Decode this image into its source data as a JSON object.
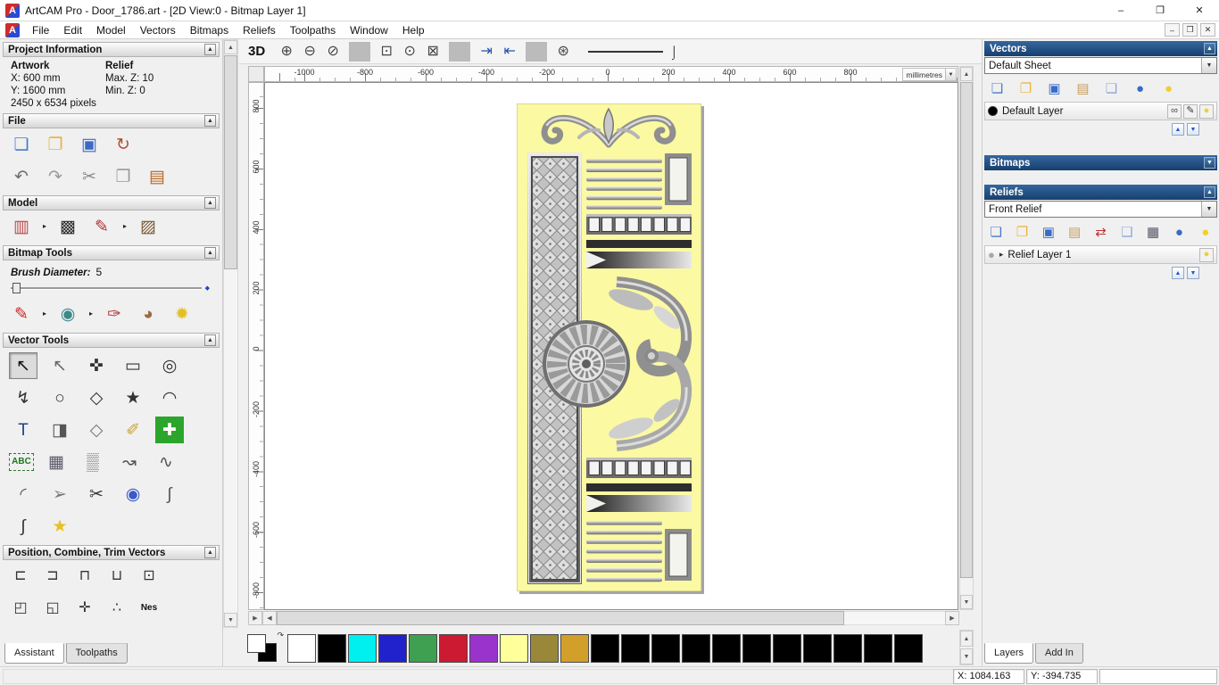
{
  "window": {
    "title": "ArtCAM Pro - Door_1786.art - [2D View:0 - Bitmap Layer 1]",
    "app_initial": "A"
  },
  "glyphs": {
    "up": "▲",
    "down": "▼",
    "left": "◀",
    "right": "▶",
    "combo_down": "▼",
    "minimize": "–",
    "restore": "❐",
    "close": "✕",
    "swap": "↷",
    "expand": "▸",
    "diamond": "◆"
  },
  "menu": {
    "items": [
      "File",
      "Edit",
      "Model",
      "Vectors",
      "Bitmaps",
      "Reliefs",
      "Toolpaths",
      "Window",
      "Help"
    ]
  },
  "assistant": {
    "project_info": {
      "title": "Project Information",
      "artwork_heading": "Artwork",
      "relief_heading": "Relief",
      "artwork_x": "X: 600 mm",
      "artwork_y": "Y: 1600 mm",
      "relief_max": "Max. Z: 10",
      "relief_min": "Min. Z: 0",
      "pixels": "2450 x 6534 pixels"
    },
    "file_section": {
      "title": "File",
      "row1": [
        {
          "name": "new-model-icon",
          "glyph": "❏",
          "color": "#4a7ac8"
        },
        {
          "name": "open-model-icon",
          "glyph": "❐",
          "color": "#e8b43a"
        },
        {
          "name": "save-model-icon",
          "glyph": "▣",
          "color": "#3a6ac8"
        },
        {
          "name": "model-transfer-icon",
          "glyph": "↻",
          "color": "#b05030"
        }
      ],
      "row2": [
        {
          "name": "undo-icon",
          "glyph": "↶",
          "color": "#707070"
        },
        {
          "name": "redo-icon",
          "glyph": "↷",
          "color": "#9a9a9a"
        },
        {
          "name": "cut-icon",
          "glyph": "✂",
          "color": "#8a8a8a"
        },
        {
          "name": "copy-icon",
          "glyph": "❐",
          "color": "#9a9a9a"
        },
        {
          "name": "paste-icon",
          "glyph": "▤",
          "color": "#b5651d"
        }
      ]
    },
    "model_section": {
      "title": "Model",
      "icons": [
        {
          "name": "load-relief-icon",
          "glyph": "▥",
          "color": "#c04848"
        },
        {
          "name": "flyout-arrow-icon",
          "glyph": "▸",
          "color": "#222",
          "cls": "mini"
        },
        {
          "name": "greyscale-view-icon",
          "glyph": "▩",
          "color": "#2e2e2e"
        },
        {
          "name": "shape-editor-icon",
          "glyph": "✎",
          "color": "#b03030"
        },
        {
          "name": "flyout-arrow-icon",
          "glyph": "▸",
          "color": "#222",
          "cls": "mini"
        },
        {
          "name": "load-image-icon",
          "glyph": "▨",
          "color": "#7a5a32"
        }
      ]
    },
    "bitmap_tools": {
      "title": "Bitmap Tools",
      "brush_label": "Brush Diameter:",
      "brush_value": "5",
      "icons": [
        {
          "name": "paint-brush-icon",
          "glyph": "✎",
          "color": "#cc2222"
        },
        {
          "name": "flyout-arrow-icon",
          "glyph": "▸",
          "color": "#222",
          "cls": "mini"
        },
        {
          "name": "flood-fill-icon",
          "glyph": "◉",
          "color": "#3a8a8a"
        },
        {
          "name": "flyout-arrow-icon",
          "glyph": "▸",
          "color": "#222",
          "cls": "mini"
        },
        {
          "name": "draw-colour-icon",
          "glyph": "✑",
          "color": "#b04040"
        },
        {
          "name": "palette-icon",
          "glyph": "◕",
          "color": "#9a6a40"
        },
        {
          "name": "texture-splat-icon",
          "glyph": "✹",
          "color": "#e2c020"
        }
      ]
    },
    "vector_tools": {
      "title": "Vector Tools",
      "rows": [
        [
          {
            "name": "select-vectors-icon",
            "glyph": "↖",
            "color": "#111",
            "pressed": true
          },
          {
            "name": "node-editing-icon",
            "glyph": "↖",
            "color": "#666"
          },
          {
            "name": "transform-vectors-icon",
            "glyph": "✜",
            "color": "#333"
          },
          {
            "name": "rectangle-tool-icon",
            "glyph": "▭",
            "color": "#333"
          },
          {
            "name": "circle-tool-icon",
            "glyph": "◎",
            "color": "#333"
          }
        ],
        [
          {
            "name": "polyline-tool-icon",
            "glyph": "↯",
            "color": "#333"
          },
          {
            "name": "ellipse-tool-icon",
            "glyph": "○",
            "color": "#333"
          },
          {
            "name": "polygon-tool-icon",
            "glyph": "◇",
            "color": "#333"
          },
          {
            "name": "star-tool-icon",
            "glyph": "★",
            "color": "#333"
          },
          {
            "name": "arc-tool-icon",
            "glyph": "◠",
            "color": "#333"
          }
        ],
        [
          {
            "name": "text-tool-icon",
            "glyph": "T",
            "color": "#224488"
          },
          {
            "name": "mirror-vectors-icon",
            "glyph": "◨",
            "color": "#555"
          },
          {
            "name": "offset-vectors-icon",
            "glyph": "◇",
            "color": "#777"
          },
          {
            "name": "measure-tool-icon",
            "glyph": "✐",
            "color": "#c8a030"
          },
          {
            "name": "block-paste-icon",
            "glyph": "✚",
            "color": "#ffffff",
            "bg": "#2ba52b"
          }
        ],
        [
          {
            "name": "text-block-icon",
            "glyph": "ABC",
            "color": "#1a7a1a",
            "cls": "abc"
          },
          {
            "name": "wireframe-icon",
            "glyph": "▦",
            "color": "#556"
          },
          {
            "name": "dot-pattern-icon",
            "glyph": "▒",
            "color": "#666"
          },
          {
            "name": "bezier-curve-icon",
            "glyph": "↝",
            "color": "#555"
          },
          {
            "name": "fit-curves-icon",
            "glyph": "∿",
            "color": "#555"
          }
        ],
        [
          {
            "name": "arc-fit-icon",
            "glyph": "◜",
            "color": "#555"
          },
          {
            "name": "join-vectors-icon",
            "glyph": "➢",
            "color": "#777"
          },
          {
            "name": "trim-vectors-icon",
            "glyph": "✂",
            "color": "#333"
          },
          {
            "name": "vector-doctor-icon",
            "glyph": "◉",
            "color": "#3a5ac8"
          },
          {
            "name": "spline-icon",
            "glyph": "∫",
            "color": "#555"
          }
        ],
        [
          {
            "name": "wrap-text-curve-icon",
            "glyph": "∫",
            "color": "#333"
          },
          {
            "name": "star-wizard-icon",
            "glyph": "★",
            "color": "#e8c020"
          }
        ]
      ]
    },
    "position_section": {
      "title": "Position, Combine, Trim Vectors",
      "row1": [
        {
          "name": "align-left-icon",
          "glyph": "⊏",
          "color": "#333",
          "cls": "small"
        },
        {
          "name": "align-right-icon",
          "glyph": "⊐",
          "color": "#333",
          "cls": "small"
        },
        {
          "name": "align-top-icon",
          "glyph": "⊓",
          "color": "#333",
          "cls": "small"
        },
        {
          "name": "align-bottom-icon",
          "glyph": "⊔",
          "color": "#333",
          "cls": "small"
        },
        {
          "name": "align-centre-icon",
          "glyph": "⊡",
          "color": "#333",
          "cls": "small"
        }
      ],
      "row2": [
        {
          "name": "combine-union-icon",
          "glyph": "◰",
          "color": "#333",
          "cls": "small"
        },
        {
          "name": "combine-subtract-icon",
          "glyph": "◱",
          "color": "#333",
          "cls": "small"
        },
        {
          "name": "weld-vectors-icon",
          "glyph": "✛",
          "color": "#333",
          "cls": "small"
        },
        {
          "name": "array-copy-icon",
          "glyph": "∴",
          "color": "#333",
          "cls": "small"
        },
        {
          "name": "nest-vectors-icon",
          "glyph": "Nes",
          "color": "#111",
          "cls": "small nes"
        }
      ]
    },
    "tabs": [
      {
        "label": "Assistant",
        "active": true
      },
      {
        "label": "Toolpaths",
        "active": false
      }
    ]
  },
  "canvas": {
    "toolbar": {
      "view_button": "3D",
      "icons": [
        {
          "name": "zoom-in-icon",
          "glyph": "⊕",
          "color": "#444"
        },
        {
          "name": "zoom-out-icon",
          "glyph": "⊖",
          "color": "#444"
        },
        {
          "name": "zoom-previous-icon",
          "glyph": "⊘",
          "color": "#444"
        },
        {
          "name": "sep",
          "cls": "sep"
        },
        {
          "name": "zoom-window-icon",
          "glyph": "⊡",
          "color": "#444"
        },
        {
          "name": "zoom-1to1-icon",
          "glyph": "⊙",
          "color": "#444"
        },
        {
          "name": "zoom-fit-icon",
          "glyph": "⊠",
          "color": "#444"
        },
        {
          "name": "sep",
          "cls": "sep"
        },
        {
          "name": "snap-grid-icon",
          "glyph": "⇥",
          "color": "#2255aa"
        },
        {
          "name": "snap-guides-icon",
          "glyph": "⇤",
          "color": "#2255aa"
        },
        {
          "name": "sep",
          "cls": "sep"
        },
        {
          "name": "zoom-object-icon",
          "glyph": "⊛",
          "color": "#444"
        }
      ]
    },
    "ruler_h": {
      "labels": [
        "-1000",
        "-800",
        "-600",
        "-400",
        "-200",
        "0",
        "200",
        "400",
        "600",
        "800"
      ],
      "units": "millimetres"
    },
    "ruler_v": {
      "labels": [
        "800",
        "600",
        "400",
        "200",
        "0",
        "-200",
        "-400",
        "-600",
        "-800"
      ]
    }
  },
  "artwork": {
    "background": "#fbf9a2"
  },
  "palette": {
    "colors": [
      "#ffffff",
      "#000000",
      "#00f0f0",
      "#2222cc",
      "#3fa052",
      "#cc1a33",
      "#9933cc",
      "#ffff9c",
      "#99883a",
      "#d2a02a",
      "#000000",
      "#000000",
      "#000000",
      "#000000",
      "#000000",
      "#000000",
      "#000000",
      "#000000",
      "#000000",
      "#000000",
      "#000000"
    ]
  },
  "layers_panel": {
    "vectors": {
      "title": "Vectors",
      "sheet_selector": "Default Sheet",
      "toolbar": [
        {
          "name": "new-vector-layer-icon",
          "glyph": "❏",
          "color": "#4a7ac8"
        },
        {
          "name": "open-vector-layer-icon",
          "glyph": "❐",
          "color": "#e8b43a"
        },
        {
          "name": "save-vector-layer-icon",
          "glyph": "▣",
          "color": "#3a6ac8"
        },
        {
          "name": "merge-layers-icon",
          "glyph": "▤",
          "color": "#c8a060"
        },
        {
          "name": "new-sheet-icon",
          "glyph": "❏",
          "color": "#8aa8d8"
        },
        {
          "name": "snap-sphere-icon",
          "glyph": "●",
          "color": "#3a6ac8"
        },
        {
          "name": "toggle-visibility-all-icon",
          "glyph": "●",
          "color": "#f0d030"
        }
      ],
      "layer": {
        "name": "Default Layer",
        "swatch": "#000000"
      },
      "layer_icons": [
        {
          "name": "lock-layer-icon",
          "glyph": "∞",
          "color": "#445"
        },
        {
          "name": "edit-layer-icon",
          "glyph": "✎",
          "color": "#333"
        },
        {
          "name": "layer-visibility-icon",
          "glyph": "●",
          "color": "#f0d030"
        }
      ]
    },
    "bitmaps": {
      "title": "Bitmaps"
    },
    "reliefs": {
      "title": "Reliefs",
      "selector": "Front Relief",
      "toolbar": [
        {
          "name": "new-relief-layer-icon",
          "glyph": "❏",
          "color": "#4a7ac8"
        },
        {
          "name": "open-relief-layer-icon",
          "glyph": "❐",
          "color": "#e8b43a"
        },
        {
          "name": "save-relief-layer-icon",
          "glyph": "▣",
          "color": "#3a6ac8"
        },
        {
          "name": "merge-relief-icon",
          "glyph": "▤",
          "color": "#c8a060"
        },
        {
          "name": "transfer-relief-icon",
          "glyph": "⇄",
          "color": "#c03030"
        },
        {
          "name": "new-relief-sheet-icon",
          "glyph": "❏",
          "color": "#8aa8d8"
        },
        {
          "name": "relief-grid-icon",
          "glyph": "▦",
          "color": "#556"
        },
        {
          "name": "relief-sphere-icon",
          "glyph": "●",
          "color": "#3a6ac8"
        },
        {
          "name": "relief-visibility-all-icon",
          "glyph": "●",
          "color": "#f0d030"
        }
      ],
      "layer": {
        "name": "Relief Layer 1"
      }
    },
    "tabs": [
      {
        "label": "Layers",
        "active": true
      },
      {
        "label": "Add In",
        "active": false
      }
    ]
  },
  "status_bar": {
    "x": "X: 1084.163",
    "y": "Y: -394.735"
  }
}
